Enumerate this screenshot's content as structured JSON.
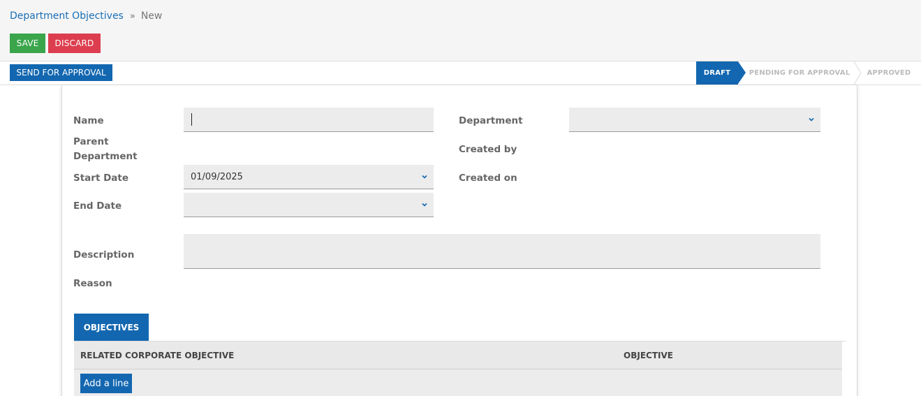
{
  "breadcrumb": {
    "parent": "Department Objectives",
    "separator": "»",
    "current": "New"
  },
  "buttons": {
    "save": "SAVE",
    "discard": "DISCARD",
    "send_for_approval": "SEND FOR APPROVAL",
    "add_line": "Add a line"
  },
  "stages": {
    "draft": "DRAFT",
    "pending": "PENDING FOR APPROVAL",
    "approved": "APPROVED",
    "active": "DRAFT"
  },
  "form": {
    "name_label": "Name",
    "name_value": "",
    "parent_department_label": "Parent Department",
    "start_date_label": "Start Date",
    "start_date_value": "01/09/2025",
    "end_date_label": "End Date",
    "end_date_value": "",
    "department_label": "Department",
    "department_value": "",
    "created_by_label": "Created by",
    "created_on_label": "Created on",
    "description_label": "Description",
    "description_value": "",
    "reason_label": "Reason"
  },
  "tabs": {
    "objectives": "OBJECTIVES"
  },
  "table": {
    "columns": [
      "RELATED CORPORATE OBJECTIVE",
      "OBJECTIVE"
    ]
  },
  "icons": {
    "dropdown": "chevron-down-icon"
  },
  "colors": {
    "primary": "#1367b0",
    "save": "#3aa54b",
    "discard": "#dd3e4f",
    "link": "#1a6fb5"
  }
}
